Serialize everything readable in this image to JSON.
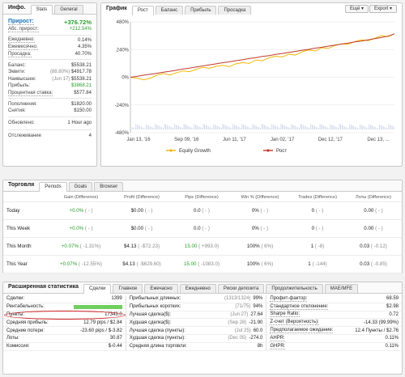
{
  "info_panel": {
    "title": "Инфо.",
    "tabs": [
      "Stats",
      "General"
    ],
    "gain_label": "Прирост:",
    "gain_value": "+376.72%",
    "abs_gain_label": "Абс. прирост:",
    "abs_gain_value": "+212.54%",
    "daily_label": "Ежедневно:",
    "daily_value": "0.14%",
    "monthly_label": "Ежемесячно:",
    "monthly_value": "4.35%",
    "drawdown_label": "Просадка:",
    "drawdown_value": "40.70%",
    "balance_label": "Баланс:",
    "balance_value": "$5538.21",
    "equity_label": "Эквити:",
    "equity_value": "$4917.78",
    "equity_pct": "(88.80%)",
    "highest_label": "Наивысшее:",
    "highest_value": "$5538.21",
    "highest_date": "(Jun 17)",
    "profit_label": "Прибыль:",
    "profit_value": "$3868.21",
    "interest_label": "Процентная ставка:",
    "interest_value": "$577.84",
    "deposits_label": "Пополнения:",
    "deposits_value": "$1820.00",
    "withdrawals_label": "Снятия:",
    "withdrawals_value": "$150.00",
    "updated_label": "Обновлено:",
    "updated_value": "1 Hour ago",
    "tracking_label": "Отслеживание",
    "tracking_value": "4"
  },
  "chart_panel": {
    "title": "График",
    "tabs": [
      "Рост",
      "Баланс",
      "Прибыль",
      "Просадка"
    ],
    "buttons": {
      "eye": "Ещё",
      "export": "Export"
    },
    "arrow": "▾"
  },
  "chart_data": {
    "type": "line",
    "x_labels": [
      "Jan 13, '16",
      "Sep 09, '16",
      "Jun 11, '17",
      "Jan 02, '17",
      "Dec 12, '17",
      "Dec 13, ..."
    ],
    "y_ticks": [
      "480%",
      "240%",
      "0%",
      "-240%",
      "-480%"
    ],
    "ylim": [
      -480,
      480
    ],
    "series": [
      {
        "name": "Equity Growth",
        "color": "#f2b705",
        "values": [
          0,
          -8,
          -22,
          -10,
          18,
          32,
          20,
          40,
          55,
          48,
          70,
          86,
          78,
          95,
          104,
          92,
          118,
          126,
          120,
          150,
          142,
          170,
          182,
          176,
          200,
          192,
          220,
          236,
          228,
          255,
          250,
          276,
          290,
          285,
          310,
          324,
          316,
          338,
          360,
          352,
          376
        ]
      },
      {
        "name": "Рост",
        "color": "#c0392b",
        "values": [
          0,
          8,
          18,
          26,
          34,
          44,
          52,
          62,
          72,
          80,
          90,
          98,
          108,
          116,
          126,
          134,
          144,
          152,
          162,
          170,
          180,
          188,
          198,
          206,
          216,
          224,
          234,
          242,
          252,
          260,
          270,
          278,
          288,
          296,
          306,
          314,
          324,
          334,
          344,
          356,
          376
        ]
      }
    ]
  },
  "trading": {
    "title": "Торговля",
    "tabs": [
      "Periods",
      "Goals",
      "Browser"
    ],
    "headers": [
      "Gain (Difference)",
      "Profit (Difference)",
      "Pips (Difference)",
      "Win % (Difference)",
      "Trades (Difference)",
      "Лоты (Difference)"
    ],
    "rows": [
      {
        "period": "Today",
        "gain": "+0.0%",
        "gain_diff": "( - )",
        "profit": "$0.00",
        "profit_diff": "( - )",
        "pips": "0.0",
        "pips_diff": "( - )",
        "win": "0%",
        "win_diff": "( - )",
        "trades": "0",
        "trades_diff": "( - )",
        "lots": "0.00",
        "lots_diff": "( - )"
      },
      {
        "period": "This Week",
        "gain": "+0.0%",
        "gain_diff": "( - )",
        "profit": "$0.00",
        "profit_diff": "( - )",
        "pips": "0.0",
        "pips_diff": "( - )",
        "win": "0%",
        "win_diff": "( - )",
        "trades": "0",
        "trades_diff": "( - )",
        "lots": "0.00",
        "lots_diff": "( - )"
      },
      {
        "period": "This Month",
        "gain": "+0.07%",
        "gain_diff": "( -1.31%)",
        "profit": "$4.13",
        "profit_diff": "( -$72.23)",
        "pips": "15.00",
        "pips_diff": "( +993.0)",
        "win": "100%",
        "win_diff": "( 6%)",
        "trades": "1",
        "trades_diff": "( -8)",
        "lots": "0.03",
        "lots_diff": "( -0.12)"
      },
      {
        "period": "This Year",
        "gain": "+0.07%",
        "gain_diff": "( -12.55%)",
        "profit": "$4.13",
        "profit_diff": "( -$629.60)",
        "pips": "15.00",
        "pips_diff": "( -1083.0)",
        "win": "100%",
        "win_diff": "( 6%)",
        "trades": "1",
        "trades_diff": "( -144)",
        "lots": "0.03",
        "lots_diff": "( -0.85)"
      }
    ]
  },
  "advanced": {
    "title": "Расширенная статистика",
    "tabs": [
      "Сделки",
      "Главное",
      "Ежечасно",
      "Ежедневно",
      "Риски депозита",
      "Продолжительность",
      "MAE/MFE"
    ],
    "col1": [
      {
        "label": "Сделки:",
        "value": "1399"
      },
      {
        "label": "Рентабельность:",
        "value": ""
      },
      {
        "label": "Пункты:",
        "value": "17343.0"
      },
      {
        "label": "Средняя прибыль:",
        "value": "12.79 pips / $2.84"
      },
      {
        "label": "Средние потери:",
        "value": "-23.60 pips / $-3.82"
      },
      {
        "label": "Лоты:",
        "value": "30.87"
      },
      {
        "label": "Комиссия:",
        "value": "$-0.44"
      }
    ],
    "col2": [
      {
        "label": "Прибыльных длинных:",
        "extra": "(1313/1324)",
        "value": "99%"
      },
      {
        "label": "Прибыльных коротких:",
        "extra": "(71/75)",
        "value": "94%"
      },
      {
        "label": "Лучшая сделка($):",
        "extra": "(Jun 27)",
        "value": "27.64"
      },
      {
        "label": "Худшая сделка($):",
        "extra": "(Sep 28)",
        "value": "-21.90"
      },
      {
        "label": "Лучшая сделка (пункты):",
        "extra": "(Jul 25)",
        "value": "60.0"
      },
      {
        "label": "Худшая сделка (пункты):",
        "extra": "(Dec 05)",
        "value": "-274.0"
      },
      {
        "label": "Средняя длина торговли:",
        "extra": "",
        "value": "8h"
      }
    ],
    "col3": [
      {
        "label": "Профит-фактор:",
        "value": "68.59"
      },
      {
        "label": "Стандартное отклонение:",
        "value": "$2.98"
      },
      {
        "label": "Sharpe Ratio:",
        "value": "0.72"
      },
      {
        "label": "Z-счет (Вероятность):",
        "value": "-14.33 (99.99%)"
      },
      {
        "label": "Предполагаемое ожидание:",
        "value": "12.4 Пункты / $2.76"
      },
      {
        "label": "AHPR:",
        "value": "0.11%"
      },
      {
        "label": "GHPR:",
        "value": "0.11%"
      }
    ],
    "profitability_color": "#6fcf5f",
    "highlight_color": "#cc1f1f"
  }
}
